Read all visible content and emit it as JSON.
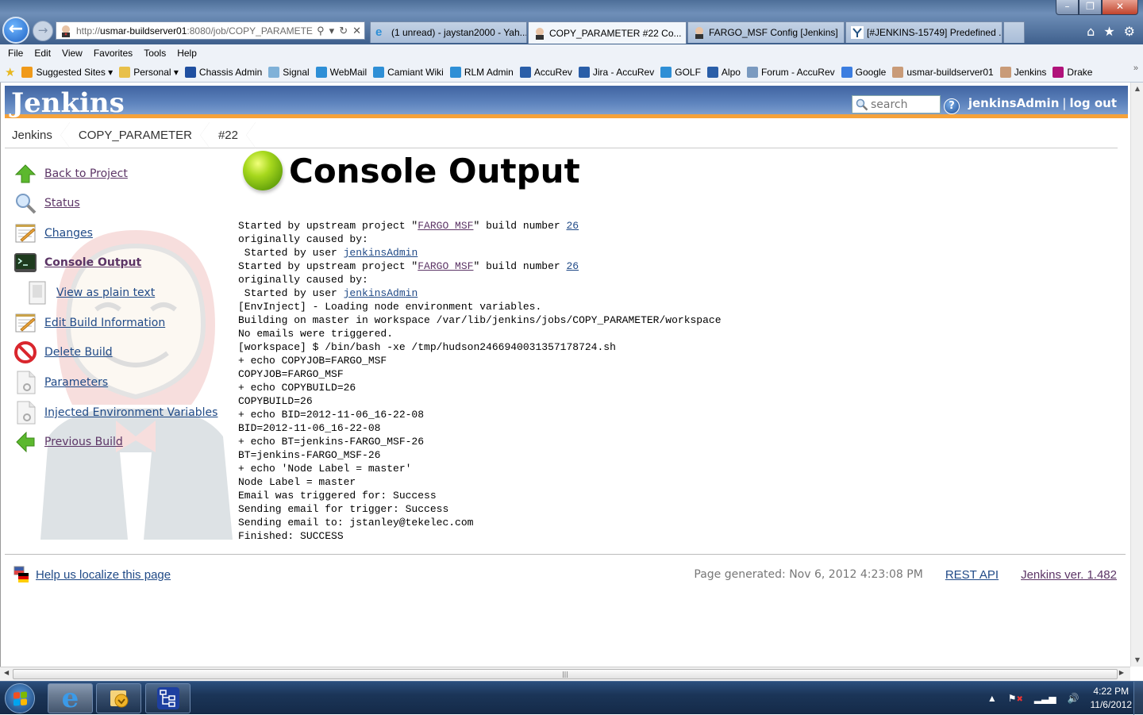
{
  "browser": {
    "address_url_prefix": "http://",
    "address_host": "usmar-buildserver01",
    "address_rest": ":8080/job/COPY_PARAMETE",
    "tabs": [
      {
        "label": "(1 unread) - jaystan2000 - Yah...",
        "icon": "ie-icon",
        "active": false
      },
      {
        "label": "COPY_PARAMETER #22 Co...",
        "icon": "jenkins-icon",
        "active": true
      },
      {
        "label": "FARGO_MSF Config [Jenkins]",
        "icon": "jenkins-icon",
        "active": false
      },
      {
        "label": "[#JENKINS-15749] Predefined ...",
        "icon": "jira-icon",
        "active": false
      }
    ],
    "menu": [
      "File",
      "Edit",
      "View",
      "Favorites",
      "Tools",
      "Help"
    ],
    "favorites": [
      {
        "label": "Suggested Sites ▾",
        "icon": "suggested-sites-icon",
        "color": "#f09a1a"
      },
      {
        "label": "Personal ▾",
        "icon": "folder-icon",
        "color": "#e8c04a"
      },
      {
        "label": "Chassis Admin",
        "icon": "hp-icon",
        "color": "#1f4fa0"
      },
      {
        "label": "Signal",
        "icon": "signal-icon",
        "color": "#7fb1d8"
      },
      {
        "label": "WebMail",
        "icon": "ie-page-icon",
        "color": "#2e8fd6"
      },
      {
        "label": "Camiant Wiki",
        "icon": "ie-page-icon",
        "color": "#2e8fd6"
      },
      {
        "label": "RLM Admin",
        "icon": "ie-page-icon",
        "color": "#2e8fd6"
      },
      {
        "label": "AccuRev",
        "icon": "accurev-icon",
        "color": "#2a5ea8"
      },
      {
        "label": "Jira - AccuRev",
        "icon": "accurev-icon",
        "color": "#2a5ea8"
      },
      {
        "label": "GOLF",
        "icon": "ie-page-icon",
        "color": "#2e8fd6"
      },
      {
        "label": "Alpo",
        "icon": "accurev-icon",
        "color": "#2a5ea8"
      },
      {
        "label": "Forum - AccuRev",
        "icon": "gear-icon",
        "color": "#7a9ac0"
      },
      {
        "label": "Google",
        "icon": "google-icon",
        "color": "#3b7de0"
      },
      {
        "label": "usmar-buildserver01",
        "icon": "jenkins-icon",
        "color": "#c99b78"
      },
      {
        "label": "Jenkins",
        "icon": "jenkins-icon",
        "color": "#c99b78"
      },
      {
        "label": "Drake",
        "icon": "feather-icon",
        "color": "#b0127a"
      }
    ],
    "more_label": "»"
  },
  "jenkins": {
    "logo": "Jenkins",
    "search_placeholder": "search",
    "help_label": "?",
    "user": "jenkinsAdmin",
    "separator": "|",
    "logout": "log out",
    "breadcrumbs": [
      "Jenkins",
      "COPY_PARAMETER",
      "#22"
    ],
    "tasks": [
      {
        "label": "Back to Project",
        "icon": "up-arrow-icon",
        "visited": true
      },
      {
        "label": "Status",
        "icon": "magnifier-icon",
        "visited": true
      },
      {
        "label": "Changes",
        "icon": "notepad-icon",
        "visited": false
      },
      {
        "label": "Console Output",
        "icon": "terminal-icon",
        "current": true
      },
      {
        "label": "View as plain text",
        "icon": "document-icon",
        "sub": true
      },
      {
        "label": "Edit Build Information",
        "icon": "notepad-icon",
        "visited": false
      },
      {
        "label": "Delete Build",
        "icon": "no-entry-icon",
        "visited": false
      },
      {
        "label": "Parameters",
        "icon": "settings-document-icon",
        "visited": false
      },
      {
        "label": "Injected Environment Variables",
        "icon": "settings-document-icon",
        "visited": false
      },
      {
        "label": "Previous Build",
        "icon": "left-arrow-icon",
        "visited": true
      }
    ],
    "page_title": "Console Output",
    "build_status": "success",
    "status_color": "#7ab51d",
    "console": {
      "lines": [
        {
          "parts": [
            {
              "t": "Started by upstream project \""
            },
            {
              "t": "FARGO_MSF",
              "link": "visited"
            },
            {
              "t": "\" build number "
            },
            {
              "t": "26",
              "link": "normal"
            }
          ]
        },
        {
          "parts": [
            {
              "t": "originally caused by:"
            }
          ]
        },
        {
          "parts": [
            {
              "t": " Started by user "
            },
            {
              "t": "jenkinsAdmin",
              "link": "normal"
            }
          ]
        },
        {
          "parts": [
            {
              "t": "Started by upstream project \""
            },
            {
              "t": "FARGO_MSF",
              "link": "visited"
            },
            {
              "t": "\" build number "
            },
            {
              "t": "26",
              "link": "normal"
            }
          ]
        },
        {
          "parts": [
            {
              "t": "originally caused by:"
            }
          ]
        },
        {
          "parts": [
            {
              "t": " Started by user "
            },
            {
              "t": "jenkinsAdmin",
              "link": "normal"
            }
          ]
        },
        {
          "parts": [
            {
              "t": "[EnvInject] - Loading node environment variables."
            }
          ]
        },
        {
          "parts": [
            {
              "t": "Building on master in workspace /var/lib/jenkins/jobs/COPY_PARAMETER/workspace"
            }
          ]
        },
        {
          "parts": [
            {
              "t": "No emails were triggered."
            }
          ]
        },
        {
          "parts": [
            {
              "t": "[workspace] $ /bin/bash -xe /tmp/hudson2466940031357178724.sh"
            }
          ]
        },
        {
          "parts": [
            {
              "t": "+ echo COPYJOB=FARGO_MSF"
            }
          ]
        },
        {
          "parts": [
            {
              "t": "COPYJOB=FARGO_MSF"
            }
          ]
        },
        {
          "parts": [
            {
              "t": "+ echo COPYBUILD=26"
            }
          ]
        },
        {
          "parts": [
            {
              "t": "COPYBUILD=26"
            }
          ]
        },
        {
          "parts": [
            {
              "t": "+ echo BID=2012-11-06_16-22-08"
            }
          ]
        },
        {
          "parts": [
            {
              "t": "BID=2012-11-06_16-22-08"
            }
          ]
        },
        {
          "parts": [
            {
              "t": "+ echo BT=jenkins-FARGO_MSF-26"
            }
          ]
        },
        {
          "parts": [
            {
              "t": "BT=jenkins-FARGO_MSF-26"
            }
          ]
        },
        {
          "parts": [
            {
              "t": "+ echo 'Node Label = master'"
            }
          ]
        },
        {
          "parts": [
            {
              "t": "Node Label = master"
            }
          ]
        },
        {
          "parts": [
            {
              "t": "Email was triggered for: Success"
            }
          ]
        },
        {
          "parts": [
            {
              "t": "Sending email for trigger: Success"
            }
          ]
        },
        {
          "parts": [
            {
              "t": "Sending email to: jstanley@tekelec.com"
            }
          ]
        },
        {
          "parts": [
            {
              "t": "Finished: SUCCESS"
            }
          ]
        }
      ]
    },
    "footer": {
      "localize": "Help us localize this page",
      "generated": "Page generated: Nov 6, 2012 4:23:08 PM",
      "rest_api": "REST API",
      "version": "Jenkins ver. 1.482"
    }
  },
  "taskbar": {
    "apps": [
      {
        "name": "internet-explorer",
        "active": true
      },
      {
        "name": "outlook",
        "active": false
      },
      {
        "name": "network-diagram-app",
        "active": false
      }
    ],
    "clock_time": "4:22 PM",
    "clock_date": "11/6/2012"
  }
}
